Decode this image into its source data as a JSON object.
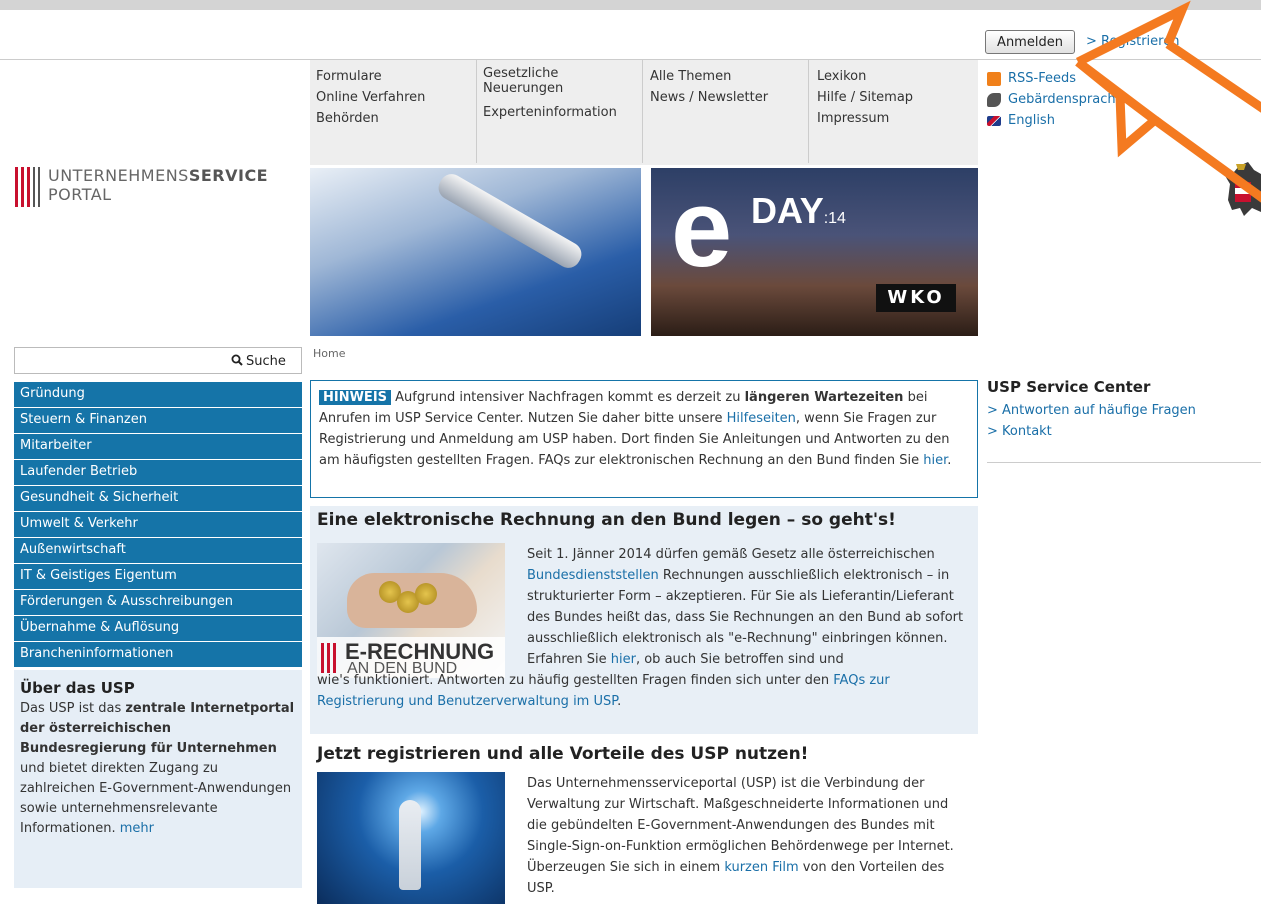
{
  "header": {
    "login_label": "Anmelden",
    "register_label": "> Registrieren"
  },
  "logo": {
    "line1_regular": "UNTERNEHMENS",
    "line1_bold": "SERVICE",
    "line2": "PORTAL"
  },
  "topnav": {
    "col1": [
      "Formulare",
      "Online Verfahren",
      "Behörden"
    ],
    "col2": [
      "Gesetzliche Neuerungen",
      "Experteninformation"
    ],
    "col3": [
      "Alle Themen",
      "News / Newsletter"
    ],
    "col4": [
      "Lexikon",
      "Hilfe / Sitemap",
      "Impressum"
    ]
  },
  "side_links": {
    "rss": "RSS-Feeds",
    "sign": "Gebärdensprache",
    "english": "English"
  },
  "banners": {
    "eday_letter": "e",
    "eday_text": "DAY",
    "eday_year": ":14",
    "wko": "WKO"
  },
  "search": {
    "placeholder": "",
    "button_label": "Suche"
  },
  "leftnav": {
    "items": [
      "Gründung",
      "Steuern & Finanzen",
      "Mitarbeiter",
      "Laufender Betrieb",
      "Gesundheit & Sicherheit",
      "Umwelt & Verkehr",
      "Außenwirtschaft",
      "IT & Geistiges Eigentum",
      "Förderungen & Ausschreibungen",
      "Übernahme & Auflösung",
      "Brancheninformationen"
    ]
  },
  "about": {
    "title": "Über das USP",
    "t1": "Das USP ist das ",
    "b1": "zentrale Internetportal der österreichischen Bundesregierung für Unternehmen",
    "t2": " und bietet direkten Zugang zu zahlreichen E-Government-Anwendungen sowie unternehmensrelevante Informationen. ",
    "more": "mehr"
  },
  "breadcrumb": "Home",
  "notice": {
    "badge": "HINWEIS",
    "t1": " Aufgrund intensiver Nachfragen kommt es derzeit zu ",
    "b1": "längeren Wartezeiten",
    "t2": " bei Anrufen im USP Service Center. Nutzen Sie daher bitte unsere ",
    "link1": "Hilfeseiten",
    "t3": ", wenn Sie Fragen zur Registrierung und Anmeldung am USP haben. Dort finden Sie Anleitungen und Antworten zu den am häufigsten gestellten Fragen. FAQs zur elektronischen Rechnung an den Bund finden Sie ",
    "link2": "hier",
    "t4": "."
  },
  "article1": {
    "title": "Eine elektronische Rechnung an den Bund legen – so geht's!",
    "img_label1": "E-RECHNUNG",
    "img_label2": "AN DEN BUND",
    "t1": "Seit 1. Jänner 2014 dürfen gemäß Gesetz alle österreichischen ",
    "link1": "Bundesdienststellen",
    "t2": " Rechnungen ausschließlich elektronisch – in strukturierter Form – akzeptieren. Für Sie als Lieferantin/Lieferant des Bundes heißt das, dass Sie Rechnungen an den Bund ab sofort ausschließlich elektronisch als \"e-Rechnung\" einbringen können. Erfahren Sie ",
    "link2": "hier",
    "t3": ", ob auch Sie betroffen sind und",
    "t4": "wie's funktioniert. Antworten zu häufig gestellten Fragen finden sich unter den ",
    "link3": "FAQs zur Registrierung und Benutzerverwaltung im USP",
    "t5": "."
  },
  "article2": {
    "title": "Jetzt registrieren und alle Vorteile des USP nutzen!",
    "t1": "Das Unternehmensserviceportal (USP) ist die Verbindung der Verwaltung zur Wirtschaft. Maßgeschneiderte Informationen und die gebündelten E-Government-Anwendungen des Bundes mit Single-Sign-on-Funktion ermöglichen Behördenwege per Internet. Überzeugen Sie sich in einem ",
    "link1": "kurzen Film",
    "t2": " von den Vorteilen des USP."
  },
  "right_panel": {
    "title": "USP Service Center",
    "links": [
      "> Antworten auf häufige Fragen",
      "> Kontakt"
    ]
  },
  "colors": {
    "nav_blue": "#1574a8",
    "link_blue": "#1a6fa8",
    "annotation_orange": "#f47a20",
    "brand_red": "#c8102e"
  }
}
